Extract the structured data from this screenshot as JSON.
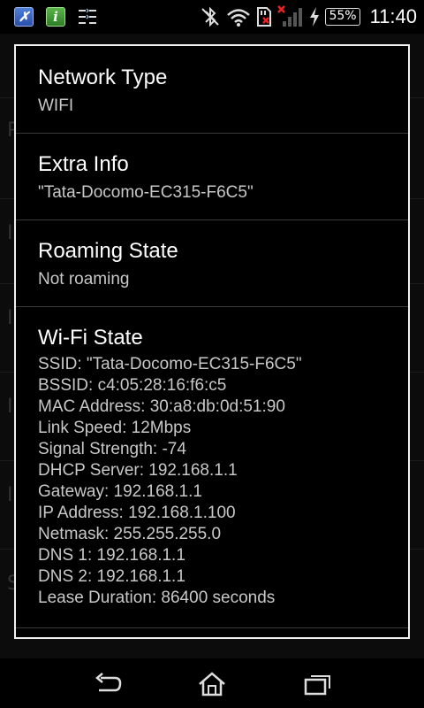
{
  "status_bar": {
    "battery": "55%",
    "time": "11:40",
    "icons": [
      "app-x-icon",
      "info-app-icon",
      "sort-list-icon",
      "bluetooth-off-icon",
      "wifi-icon",
      "sd-card-error-icon",
      "signal-off-icon",
      "charging-icon"
    ]
  },
  "dialog": {
    "network_type": {
      "title": "Network Type",
      "value": "WIFI"
    },
    "extra_info": {
      "title": "Extra Info",
      "value": "\"Tata-Docomo-EC315-F6C5\""
    },
    "roaming_state": {
      "title": "Roaming State",
      "value": "Not roaming"
    },
    "wifi_state": {
      "title": "Wi-Fi State",
      "lines": [
        "SSID: \"Tata-Docomo-EC315-F6C5\"",
        "BSSID: c4:05:28:16:f6:c5",
        "MAC Address: 30:a8:db:0d:51:90",
        "Link Speed: 12Mbps",
        "Signal Strength: -74",
        "DHCP Server: 192.168.1.1",
        "Gateway: 192.168.1.1",
        "IP Address: 192.168.1.100",
        "Netmask: 255.255.255.0",
        "DNS 1: 192.168.1.1",
        "DNS 2: 192.168.1.1",
        "Lease Duration: 86400 seconds"
      ]
    }
  },
  "background": {
    "letters": [
      "P",
      "I",
      "I",
      "I",
      "I",
      "S"
    ]
  },
  "nav_bar": {
    "buttons": [
      "back-icon",
      "home-icon",
      "recent-apps-icon"
    ]
  }
}
